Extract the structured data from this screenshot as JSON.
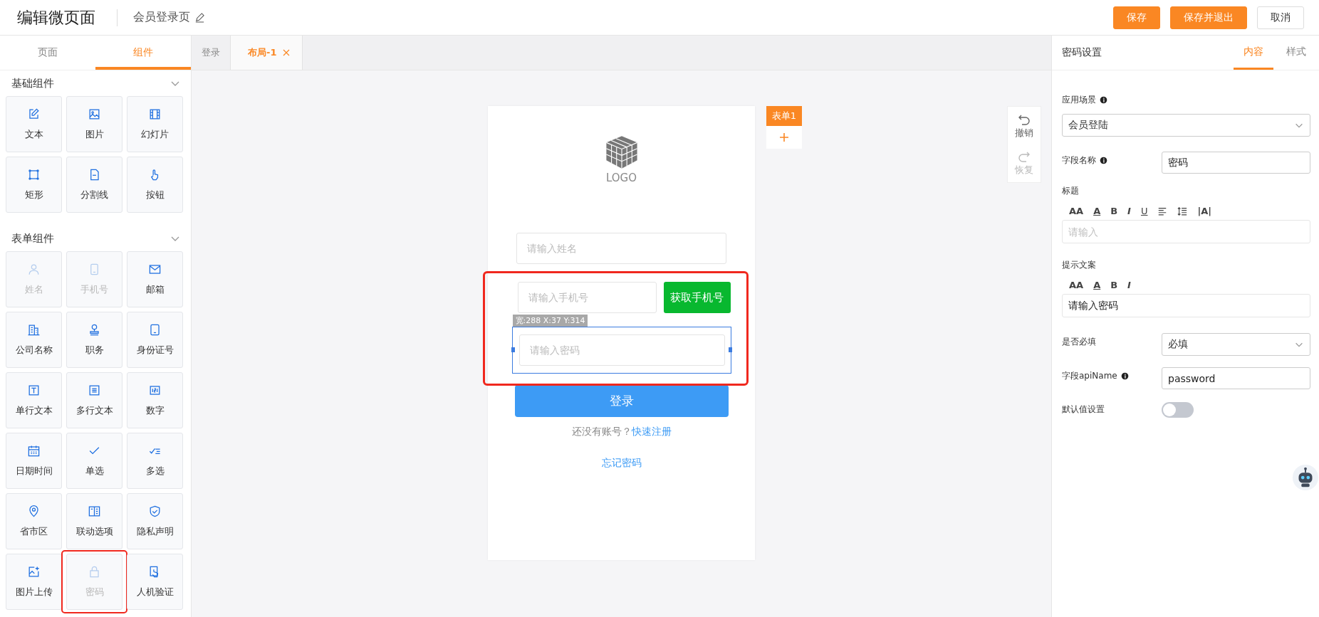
{
  "header": {
    "title": "编辑微页面",
    "page_name": "会员登录页",
    "buttons": [
      {
        "label": "保存",
        "kind": "primary"
      },
      {
        "label": "保存并退出",
        "kind": "primary"
      },
      {
        "label": "取消",
        "kind": "default"
      }
    ]
  },
  "left_panel": {
    "tabs": [
      {
        "label": "页面",
        "selected": false
      },
      {
        "label": "组件",
        "selected": true
      }
    ],
    "groups": [
      {
        "title": "基础组件",
        "expanded": true,
        "items": [
          {
            "label": "文本",
            "disabled": false,
            "highlighted": false
          },
          {
            "label": "图片",
            "disabled": false,
            "highlighted": false
          },
          {
            "label": "幻灯片",
            "disabled": false,
            "highlighted": false
          },
          {
            "label": "矩形",
            "disabled": false,
            "highlighted": false
          },
          {
            "label": "分割线",
            "disabled": false,
            "highlighted": false
          },
          {
            "label": "按钮",
            "disabled": false,
            "highlighted": false
          }
        ]
      },
      {
        "title": "表单组件",
        "expanded": true,
        "items": [
          {
            "label": "姓名",
            "disabled": true,
            "highlighted": false
          },
          {
            "label": "手机号",
            "disabled": true,
            "highlighted": false
          },
          {
            "label": "邮箱",
            "disabled": false,
            "highlighted": false
          },
          {
            "label": "公司名称",
            "disabled": false,
            "highlighted": false
          },
          {
            "label": "职务",
            "disabled": false,
            "highlighted": false
          },
          {
            "label": "身份证号",
            "disabled": false,
            "highlighted": false
          },
          {
            "label": "单行文本",
            "disabled": false,
            "highlighted": false
          },
          {
            "label": "多行文本",
            "disabled": false,
            "highlighted": false
          },
          {
            "label": "数字",
            "disabled": false,
            "highlighted": false
          },
          {
            "label": "日期时间",
            "disabled": false,
            "highlighted": false
          },
          {
            "label": "单选",
            "disabled": false,
            "highlighted": false
          },
          {
            "label": "多选",
            "disabled": false,
            "highlighted": false
          },
          {
            "label": "省市区",
            "disabled": false,
            "highlighted": false
          },
          {
            "label": "联动选项",
            "disabled": false,
            "highlighted": false
          },
          {
            "label": "隐私声明",
            "disabled": false,
            "highlighted": false
          },
          {
            "label": "图片上传",
            "disabled": false,
            "highlighted": false
          },
          {
            "label": "密码",
            "disabled": true,
            "highlighted": true
          },
          {
            "label": "人机验证",
            "disabled": false,
            "highlighted": false
          }
        ]
      }
    ]
  },
  "editor_tabs": [
    {
      "label": "登录",
      "selected": false,
      "closable": false
    },
    {
      "label": "布局-1",
      "selected": true,
      "closable": true
    }
  ],
  "phone": {
    "logo": "LOGO",
    "name_placeholder": "请输入姓名",
    "phone_placeholder": "请输入手机号",
    "phone_button": "获取手机号",
    "password": {
      "placeholder": "请输入密码",
      "selected": true,
      "selection_info": "宽:288 X:37 Y:314"
    },
    "highlighted": true,
    "login_button": "登录",
    "register_prompt": "还没有账号？",
    "register_link": "快速注册",
    "forgot_link": "忘记密码"
  },
  "form_tag": "表单1",
  "history": [
    {
      "label": "撤销",
      "disabled": false
    },
    {
      "label": "恢复",
      "disabled": true
    }
  ],
  "right_panel": {
    "title": "密码设置",
    "tabs": [
      {
        "label": "内容",
        "selected": true
      },
      {
        "label": "样式",
        "selected": false
      }
    ],
    "fields": [
      {
        "kind": "select_block",
        "label": "应用场景",
        "info": true,
        "value": "会员登陆"
      },
      {
        "kind": "input",
        "label": "字段名称",
        "info": true,
        "value": "密码"
      },
      {
        "kind": "rich",
        "label": "标题",
        "tools": [
          {
            "kind": "text",
            "label": "AA"
          },
          {
            "kind": "underline-text",
            "label": "A"
          },
          {
            "kind": "bold",
            "label": "B"
          },
          {
            "kind": "italic",
            "label": "I"
          },
          {
            "kind": "underline",
            "label": "U"
          },
          {
            "kind": "align"
          },
          {
            "kind": "line-height"
          },
          {
            "kind": "text",
            "label": "|A|"
          }
        ],
        "placeholder": "请输入"
      },
      {
        "kind": "rich",
        "label": "提示文案",
        "tools": [
          {
            "kind": "text",
            "label": "AA"
          },
          {
            "kind": "underline-text",
            "label": "A"
          },
          {
            "kind": "bold",
            "label": "B"
          },
          {
            "kind": "italic",
            "label": "I"
          }
        ],
        "value": "请输入密码"
      },
      {
        "kind": "select",
        "label": "是否必填",
        "value": "必填"
      },
      {
        "kind": "input",
        "label": "字段apiName",
        "info": true,
        "value": "password"
      },
      {
        "kind": "toggle",
        "label": "默认值设置",
        "on": false
      }
    ]
  }
}
